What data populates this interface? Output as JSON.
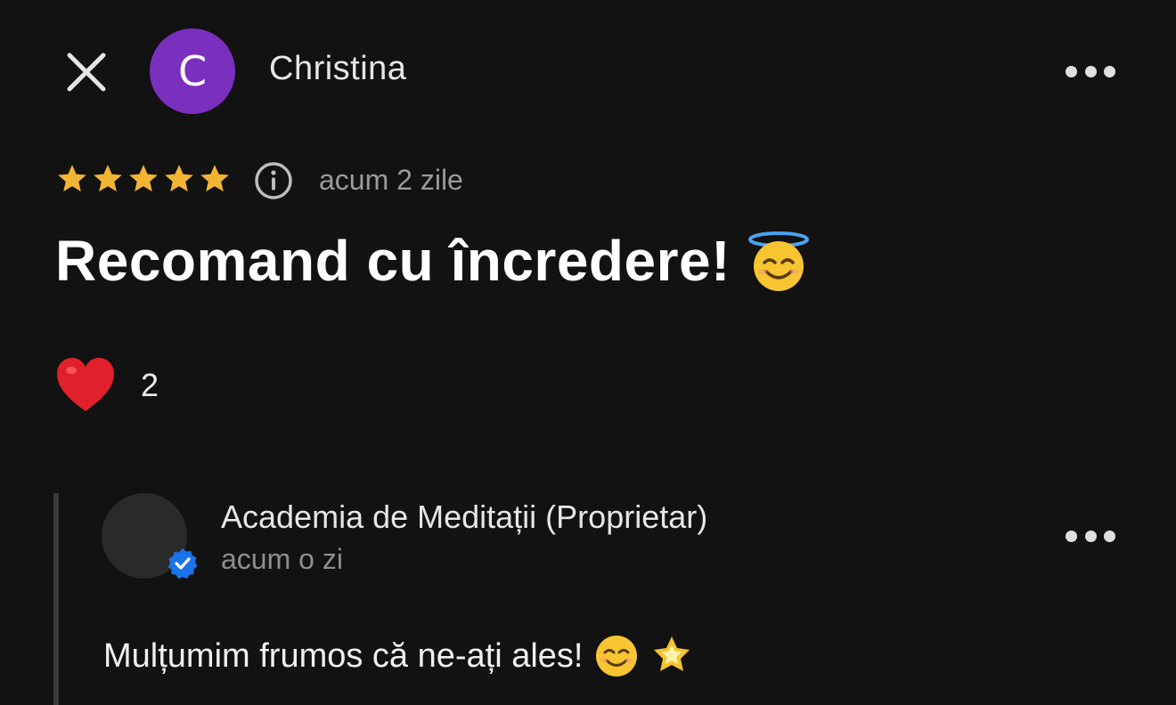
{
  "header": {
    "avatar_letter": "C",
    "avatar_color": "#7b2fbf",
    "author_name": "Christina",
    "close_icon": "close-icon",
    "more_icon": "more-horizontal-icon"
  },
  "rating": {
    "stars": 5,
    "max_stars": 5,
    "star_color": "#f2b533",
    "time_ago": "acum 2 zile"
  },
  "review": {
    "title": "Recomand cu încredere!",
    "title_emoji": "smiling-face-with-halo"
  },
  "reaction": {
    "icon": "red-heart",
    "count": "2"
  },
  "reply": {
    "owner_name": "Academia de Meditații (Proprietar)",
    "time_ago": "acum o zi",
    "verified_badge_color": "#1a73e8",
    "text": "Mulțumim frumos că ne-ați ales!",
    "emojis": [
      "smiling-face-with-smiling-eyes",
      "glowing-star"
    ]
  }
}
